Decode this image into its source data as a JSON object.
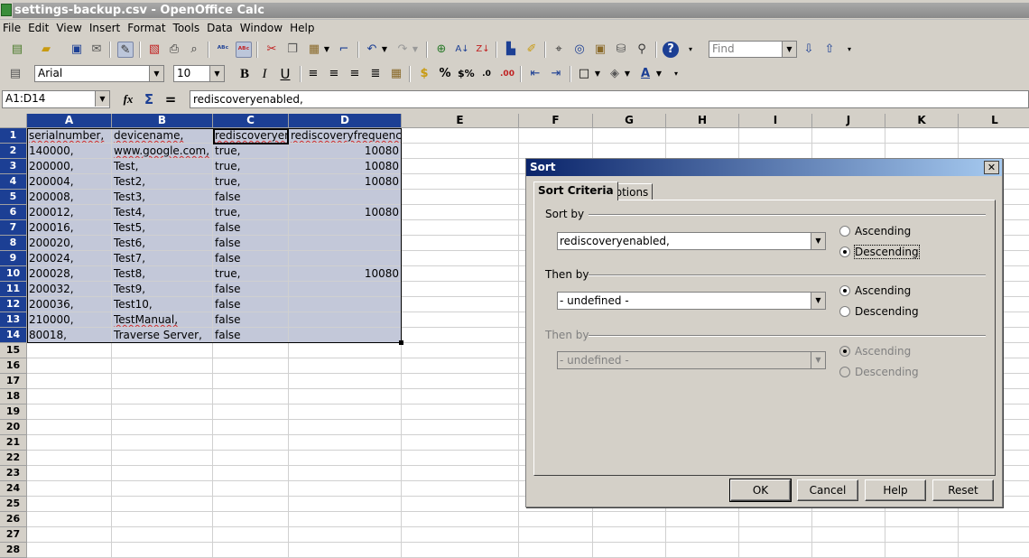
{
  "window": {
    "title": "settings-backup.csv - OpenOffice Calc"
  },
  "menu": [
    "File",
    "Edit",
    "View",
    "Insert",
    "Format",
    "Tools",
    "Data",
    "Window",
    "Help"
  ],
  "toolbar": {
    "find_placeholder": "Find"
  },
  "format_bar": {
    "font_name": "Arial",
    "font_size": "10"
  },
  "formula_bar": {
    "name_box": "A1:D14",
    "content": "rediscoveryenabled,"
  },
  "columns": [
    "A",
    "B",
    "C",
    "D",
    "E",
    "F",
    "G",
    "H",
    "I",
    "J",
    "K",
    "L"
  ],
  "rows": [
    {
      "n": "1",
      "a": "serialnumber,",
      "b": "devicename,",
      "c": "rediscoveryenabled,",
      "d": "rediscoveryfrequency"
    },
    {
      "n": "2",
      "a": "140000,",
      "b": "www.google.com,",
      "c": "true,",
      "d": "10080"
    },
    {
      "n": "3",
      "a": "200000,",
      "b": "Test,",
      "c": "true,",
      "d": "10080"
    },
    {
      "n": "4",
      "a": "200004,",
      "b": "Test2,",
      "c": "true,",
      "d": "10080"
    },
    {
      "n": "5",
      "a": "200008,",
      "b": "Test3,",
      "c": "false",
      "d": ""
    },
    {
      "n": "6",
      "a": "200012,",
      "b": "Test4,",
      "c": "true,",
      "d": "10080"
    },
    {
      "n": "7",
      "a": "200016,",
      "b": "Test5,",
      "c": "false",
      "d": ""
    },
    {
      "n": "8",
      "a": "200020,",
      "b": "Test6,",
      "c": "false",
      "d": ""
    },
    {
      "n": "9",
      "a": "200024,",
      "b": "Test7,",
      "c": "false",
      "d": ""
    },
    {
      "n": "10",
      "a": "200028,",
      "b": "Test8,",
      "c": "true,",
      "d": "10080"
    },
    {
      "n": "11",
      "a": "200032,",
      "b": "Test9,",
      "c": "false",
      "d": ""
    },
    {
      "n": "12",
      "a": "200036,",
      "b": "Test10,",
      "c": "false",
      "d": ""
    },
    {
      "n": "13",
      "a": "210000,",
      "b": "TestManual,",
      "c": "false",
      "d": ""
    },
    {
      "n": "14",
      "a": "80018,",
      "b": "Traverse Server,",
      "c": "false",
      "d": ""
    }
  ],
  "empty_rows": [
    "15",
    "16",
    "17",
    "18",
    "19",
    "20",
    "21",
    "22",
    "23",
    "24",
    "25",
    "26",
    "27",
    "28"
  ],
  "sort_dialog": {
    "title": "Sort",
    "tabs": [
      "Sort Criteria",
      "Options"
    ],
    "sort_by_label": "Sort by",
    "sort_by_value": "rediscoveryenabled,",
    "then_by_label": "Then by",
    "then_by_value": "- undefined -",
    "then_by2_label": "Then by",
    "then_by2_value": "- undefined -",
    "ascending": "Ascending",
    "descending": "Descending",
    "buttons": {
      "ok": "OK",
      "cancel": "Cancel",
      "help": "Help",
      "reset": "Reset"
    }
  }
}
